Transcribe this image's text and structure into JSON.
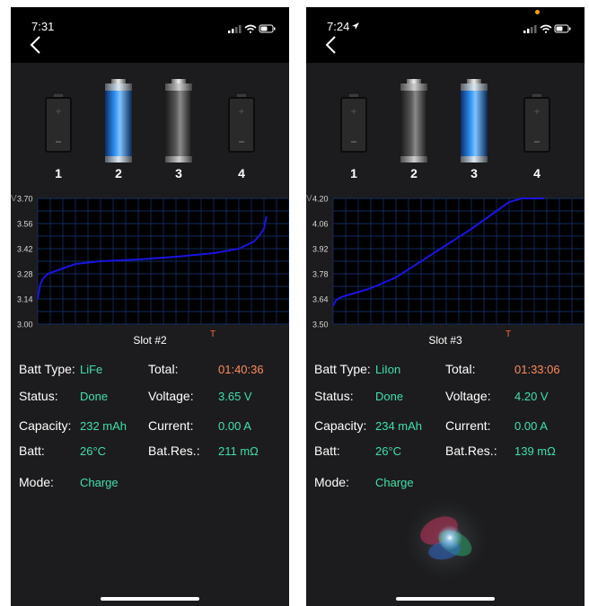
{
  "screens": [
    {
      "time": "7:31",
      "location_arrow": false,
      "slots": [
        "1",
        "2",
        "3",
        "4"
      ],
      "slot_state": [
        "empty",
        "blue",
        "gray",
        "empty"
      ],
      "chart_title": "Slot #2",
      "chart_data": {
        "type": "line",
        "y_unit_label": "V",
        "t_label": "T",
        "yticks": [
          "3.70",
          "3.56",
          "3.42",
          "3.28",
          "3.14",
          "3.00"
        ],
        "ylim": [
          3.0,
          3.7
        ],
        "xlim": [
          0,
          100
        ],
        "grid": true,
        "series": [
          {
            "x": [
              0,
              1,
              2,
              4,
              8,
              15,
              25,
              40,
              55,
              70,
              80,
              86,
              88,
              90,
              91
            ],
            "y": [
              3.14,
              3.22,
              3.25,
              3.28,
              3.3,
              3.335,
              3.35,
              3.36,
              3.375,
              3.395,
              3.42,
              3.46,
              3.49,
              3.53,
              3.6
            ]
          }
        ]
      },
      "info": {
        "batt_type_label": "Batt Type:",
        "batt_type": "LiFe",
        "total_label": "Total:",
        "total": "01:40:36",
        "status_label": "Status:",
        "status": "Done",
        "voltage_label": "Voltage:",
        "voltage": "3.65 V",
        "capacity_label": "Capacity:",
        "capacity": "232 mAh",
        "current_label": "Current:",
        "current": "0.00 A",
        "batt_label": "Batt:",
        "batt_temp": "26°C",
        "bat_res_label": "Bat.Res.:",
        "bat_res": "211 mΩ",
        "mode_label": "Mode:",
        "mode": "Charge"
      }
    },
    {
      "time": "7:24",
      "location_arrow": true,
      "slots": [
        "1",
        "2",
        "3",
        "4"
      ],
      "slot_state": [
        "empty",
        "gray",
        "blue",
        "empty"
      ],
      "chart_title": "Slot #3",
      "chart_data": {
        "type": "line",
        "y_unit_label": "V",
        "t_label": "T",
        "yticks": [
          "4.20",
          "4.06",
          "3.92",
          "3.78",
          "3.64",
          "3.50"
        ],
        "ylim": [
          3.5,
          4.2
        ],
        "xlim": [
          0,
          100
        ],
        "grid": true,
        "series": [
          {
            "x": [
              0,
              1,
              3,
              8,
              15,
              25,
              35,
              45,
              55,
              60,
              65,
              70,
              75,
              84
            ],
            "y": [
              3.6,
              3.63,
              3.65,
              3.67,
              3.7,
              3.76,
              3.85,
              3.94,
              4.03,
              4.08,
              4.13,
              4.18,
              4.2,
              4.2
            ]
          }
        ]
      },
      "info": {
        "batt_type_label": "Batt Type:",
        "batt_type": "LiIon",
        "total_label": "Total:",
        "total": "01:33:06",
        "status_label": "Status:",
        "status": "Done",
        "voltage_label": "Voltage:",
        "voltage": "4.20 V",
        "capacity_label": "Capacity:",
        "capacity": "234 mAh",
        "current_label": "Current:",
        "current": "0.00 A",
        "batt_label": "Batt:",
        "batt_temp": "26°C",
        "bat_res_label": "Bat.Res.:",
        "bat_res": "139 mΩ",
        "mode_label": "Mode:",
        "mode": "Charge"
      }
    }
  ],
  "colors": {
    "background": "#1c1c1e",
    "header": "#000000",
    "accent_green": "#3ee0a8",
    "accent_orange": "#ff8a5c",
    "line_blue": "#1a14e0",
    "grid_blue": "#123a7a"
  }
}
